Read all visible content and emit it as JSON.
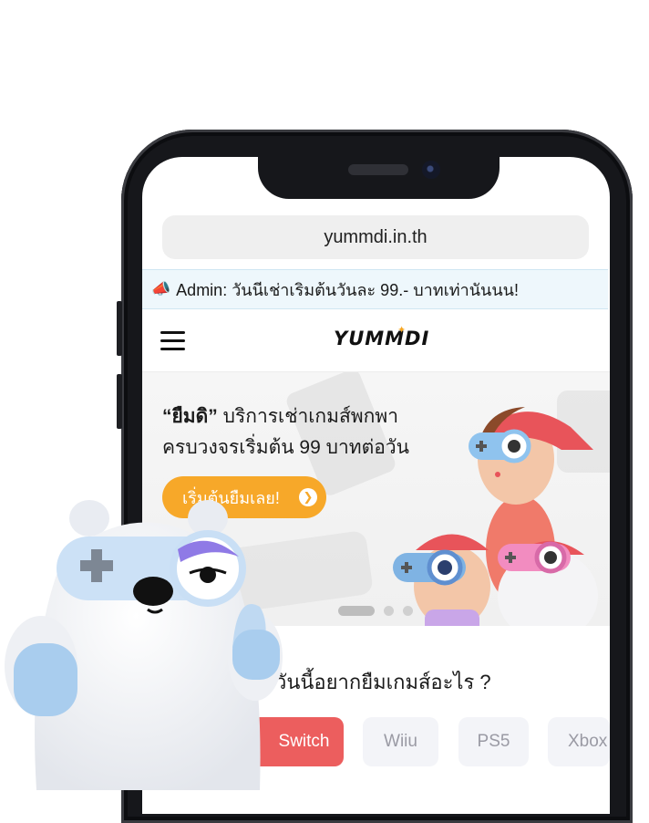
{
  "browser": {
    "url": "yummdi.in.th"
  },
  "announcement": {
    "icon": "megaphone-icon",
    "text": "Admin: วันนีเช่าเริมต้นวันละ 99.- บาทเท่านันนน!"
  },
  "nav": {
    "logo": "YUMMDI"
  },
  "hero": {
    "brand_quote": "“ยืมดิ”",
    "line1_rest": " บริการเช่าเกมส์พกพา",
    "line2": "ครบวงจรเริ่มต้น 99 บาทต่อวัน",
    "cta": "เริ่มต้นยืมเลย!",
    "slide_count": 3,
    "active_slide": 0
  },
  "section": {
    "question": "วันนี้อยากยืมเกมส์อะไร ?"
  },
  "categories": [
    {
      "label": "Switch",
      "active": true
    },
    {
      "label": "Wiiu",
      "active": false
    },
    {
      "label": "PS5",
      "active": false
    },
    {
      "label": "Xbox",
      "active": false
    }
  ],
  "colors": {
    "accent_orange": "#f7a829",
    "active_chip": "#ec5e5e",
    "banner_bg": "#eef7fc"
  }
}
